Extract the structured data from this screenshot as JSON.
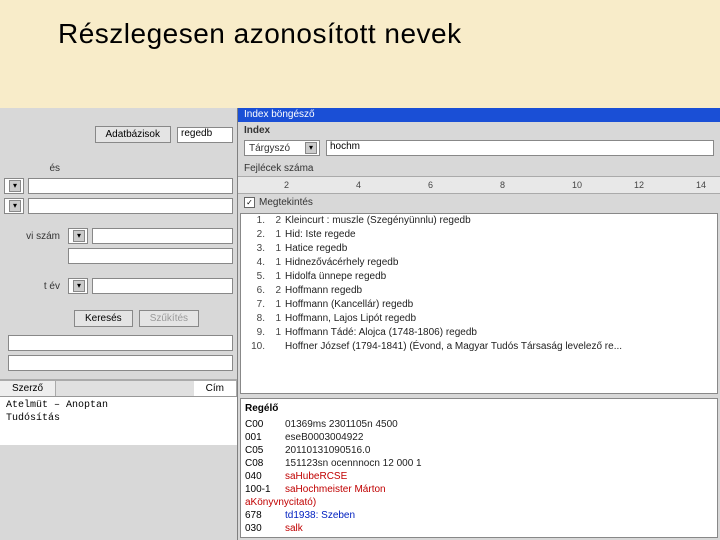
{
  "slide": {
    "title": "Részlegesen azonosított nevek"
  },
  "left": {
    "btn_db": "Adatbázisok",
    "db_value": "regedb",
    "label_es": "és",
    "label_viszam": "vi szám",
    "label_tev": "t év",
    "btn_search": "Keresés",
    "btn_narrow": "Szűkítés",
    "tabs": {
      "szoveg": "Szerző",
      "cim": "Cím"
    },
    "list": [
      "Atelmüt – Anoptan",
      "Tudósítás"
    ]
  },
  "right": {
    "titlebar": "Index böngésző",
    "panel_index": "Index",
    "field_label": "Tárgyszó",
    "field_value": "hochm",
    "ruler_label": "Fejlécek száma",
    "ruler_ticks": [
      "2",
      "4",
      "6",
      "8",
      "10",
      "12",
      "14"
    ],
    "chk_label": "Megtekintés",
    "results": [
      {
        "n": "1.",
        "c": "2",
        "t": "Kleincurt : muszle (Szegényünnlu)   regedb"
      },
      {
        "n": "2.",
        "c": "1",
        "t": "Hid: Iste  regede"
      },
      {
        "n": "3.",
        "c": "1",
        "t": "Hatice  regedb"
      },
      {
        "n": "4.",
        "c": "1",
        "t": "Hidnezővácérhely  regedb"
      },
      {
        "n": "5.",
        "c": "1",
        "t": "Hidolfa ünnepe  regedb"
      },
      {
        "n": "6.",
        "c": "2",
        "t": "Hoffmann  regedb"
      },
      {
        "n": "7.",
        "c": "1",
        "t": "Hoffmann (Kancellár)  regedb"
      },
      {
        "n": "8.",
        "c": "1",
        "t": "Hoffmann, Lajos Lipót  regedb"
      },
      {
        "n": "9.",
        "c": "1",
        "t": "Hoffmann Tádé: Alojca (1748-1806)  regedb"
      },
      {
        "n": "10.",
        "c": "",
        "t": "Hoffner József (1794-1841) (Évond, a Magyar Tudós Társaság levelező   re..."
      }
    ],
    "record": {
      "title": "Regélő",
      "lines": [
        {
          "tag": "C00",
          "cls": "blk",
          "val": "01369ms 2301105n 4500"
        },
        {
          "tag": "001",
          "cls": "blk",
          "val": "eseB0003004922"
        },
        {
          "tag": "C05",
          "cls": "blk",
          "val": "20110131090516.0"
        },
        {
          "tag": "C08",
          "cls": "blk",
          "val": "151123sn ocennnocn 12 000 1"
        },
        {
          "tag": "040",
          "cls": "red",
          "val": "saHubeRCSE"
        },
        {
          "tag": "100-1",
          "cls": "red",
          "val": "saHochmeister Márton<br>aKönyvnycitató)"
        },
        {
          "tag": "678",
          "cls": "blue",
          "val": "td1938: Szeben"
        },
        {
          "tag": "030",
          "cls": "red",
          "val": "salk"
        }
      ]
    }
  }
}
